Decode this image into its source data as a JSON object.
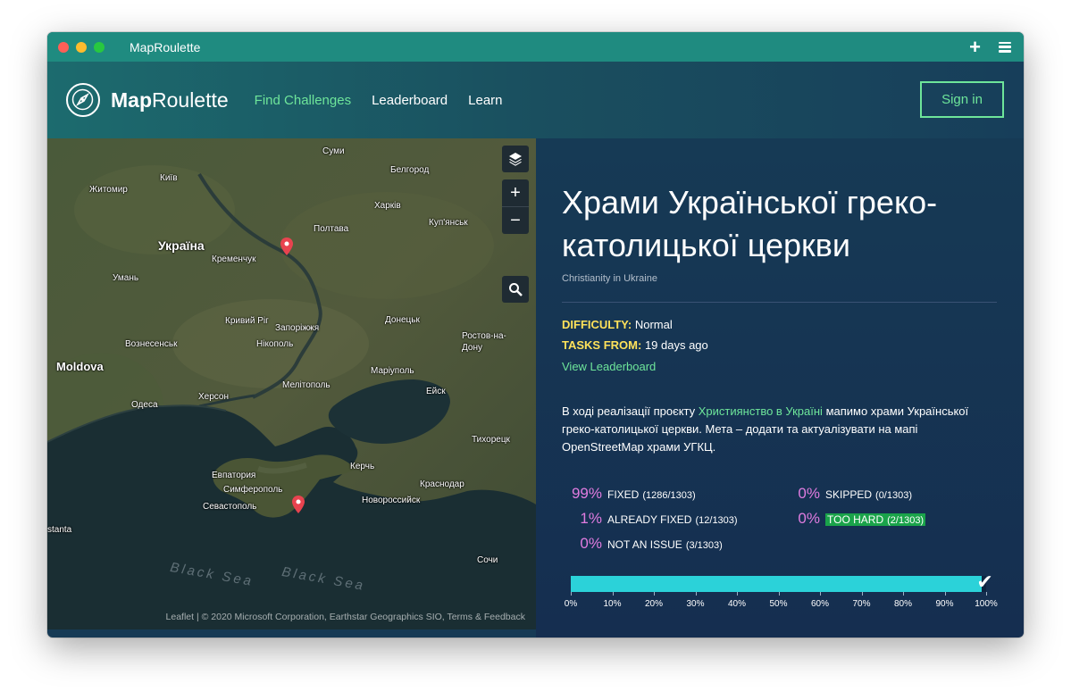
{
  "window": {
    "title": "MapRoulette"
  },
  "nav": {
    "brand_bold": "Map",
    "brand_rest": "Roulette",
    "links": [
      {
        "label": "Find Challenges",
        "active": true
      },
      {
        "label": "Leaderboard",
        "active": false
      },
      {
        "label": "Learn",
        "active": false
      }
    ],
    "signin": "Sign in"
  },
  "map": {
    "places": [
      "Суми",
      "Київ",
      "Житомир",
      "Белгород",
      "Харків",
      "Україна",
      "Полтава",
      "Куп'янськ",
      "Кременчук",
      "Умань",
      "Кривий Ріг",
      "Запоріжжя",
      "Донецьк",
      "Вознесенськ",
      "Нікополь",
      "Ростов-на-Дону",
      "Moldova",
      "Маріуполь",
      "Херсон",
      "Мелітополь",
      "Ейск",
      "Одеса",
      "Тихорецк",
      "Керчь",
      "Евпатория",
      "Симферополь",
      "Краснодар",
      "Севастополь",
      "Новороссийск",
      "stanta",
      "Сочи",
      "Black Sea",
      "Black Sea"
    ],
    "attribution": "Leaflet | © 2020 Microsoft Corporation, Earthstar Geographics SIO, Terms & Feedback"
  },
  "challenge": {
    "title": "Храми Української греко-католицької церкви",
    "parent": "Christianity in Ukraine",
    "difficulty_label": "DIFFICULTY:",
    "difficulty": "Normal",
    "tasks_from_label": "TASKS FROM:",
    "tasks_from": "19 days ago",
    "view_leaderboard": "View Leaderboard",
    "desc_before": "В ході реалізації проєкту ",
    "desc_link": "Християнство в Україні",
    "desc_after": " мапимо храми Української греко-католицької церкви. Мета – додати та актуалізувати на мапі OpenStreetMap храми УГКЦ."
  },
  "stats": [
    {
      "pct": "99%",
      "label": "FIXED",
      "count": "(1286/1303)"
    },
    {
      "pct": "1%",
      "label": "ALREADY FIXED",
      "count": "(12/1303)"
    },
    {
      "pct": "0%",
      "label": "NOT AN ISSUE",
      "count": "(3/1303)"
    },
    {
      "pct": "0%",
      "label": "SKIPPED",
      "count": "(0/1303)"
    },
    {
      "pct": "0%",
      "label": "TOO HARD",
      "count": "(2/1303)"
    }
  ],
  "progress": {
    "fraction": 0.99,
    "ticks": [
      "0%",
      "10%",
      "20%",
      "30%",
      "40%",
      "50%",
      "60%",
      "70%",
      "80%",
      "90%",
      "100%"
    ]
  },
  "colors": {
    "accent_green": "#6ee59a",
    "title_bar": "#1f8b80",
    "label_yellow": "#ffe25a",
    "stat_pink": "#e07ce0",
    "progress_cyan": "#2bd2d9"
  }
}
